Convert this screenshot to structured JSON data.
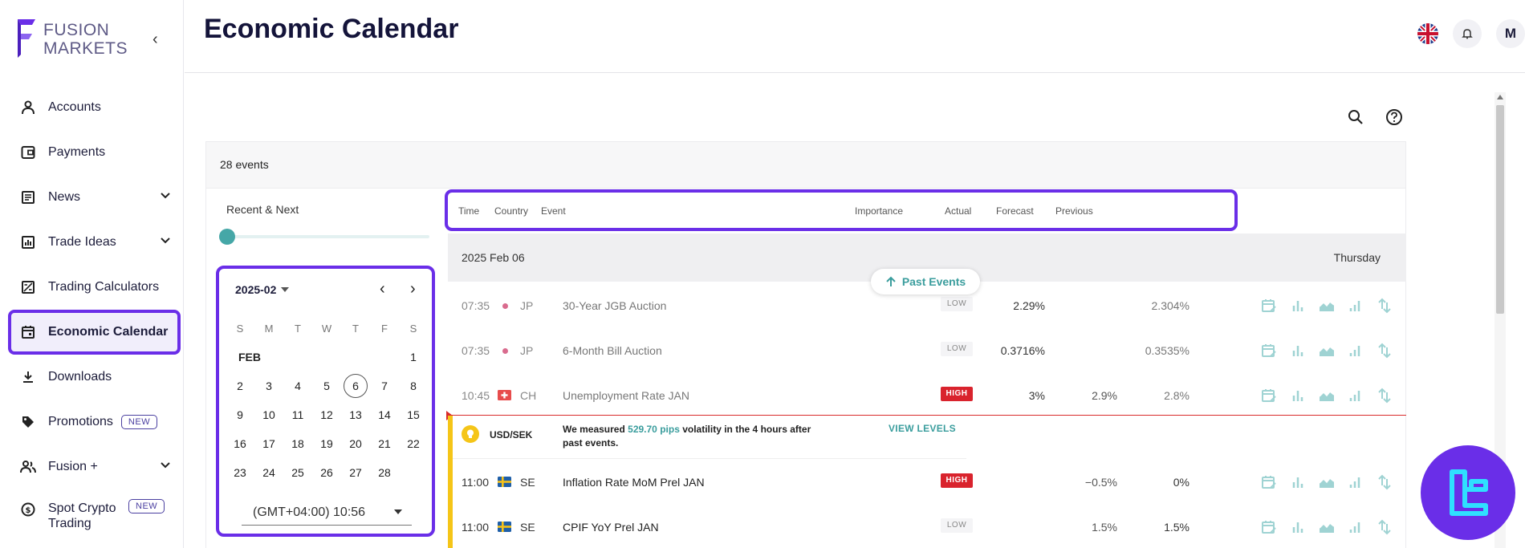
{
  "brand": {
    "line1": "FUSION",
    "line2": "MARKETS"
  },
  "page": {
    "title": "Economic Calendar"
  },
  "sidebar": {
    "items": [
      {
        "label": "Accounts"
      },
      {
        "label": "Payments"
      },
      {
        "label": "News"
      },
      {
        "label": "Trade Ideas"
      },
      {
        "label": "Trading Calculators"
      },
      {
        "label": "Economic Calendar"
      },
      {
        "label": "Downloads"
      },
      {
        "label": "Promotions",
        "badge": "NEW"
      },
      {
        "label": "Fusion +"
      },
      {
        "label": "Spot Crypto Trading",
        "badge": "NEW"
      }
    ]
  },
  "header": {
    "avatar": "M"
  },
  "panel": {
    "event_count": "28 events",
    "range_label": "Recent & Next"
  },
  "calendar": {
    "month_select": "2025-02",
    "weekdays": [
      "S",
      "M",
      "T",
      "W",
      "T",
      "F",
      "S"
    ],
    "month_label": "FEB",
    "selected_day": "6",
    "timezone": "(GMT+04:00) 10:56"
  },
  "table": {
    "headers": {
      "time": "Time",
      "country": "Country",
      "event": "Event",
      "importance": "Importance",
      "actual": "Actual",
      "forecast": "Forecast",
      "previous": "Previous"
    },
    "date": "2025 Feb 06",
    "weekday": "Thursday",
    "past_events": "Past Events",
    "rows": [
      {
        "time": "07:35",
        "country": "JP",
        "event": "30-Year JGB Auction",
        "importance": "LOW",
        "actual": "2.29%",
        "forecast": "",
        "previous": "2.304%"
      },
      {
        "time": "07:35",
        "country": "JP",
        "event": "6-Month Bill Auction",
        "importance": "LOW",
        "actual": "0.3716%",
        "forecast": "",
        "previous": "0.3535%"
      },
      {
        "time": "10:45",
        "country": "CH",
        "event": "Unemployment Rate JAN",
        "importance": "HIGH",
        "actual": "3%",
        "forecast": "2.9%",
        "previous": "2.8%"
      },
      {
        "time": "11:00",
        "country": "SE",
        "event": "Inflation Rate MoM Prel JAN",
        "importance": "HIGH",
        "actual": "",
        "forecast": "−0.5%",
        "previous": "0%"
      },
      {
        "time": "11:00",
        "country": "SE",
        "event": "CPIF YoY Prel JAN",
        "importance": "LOW",
        "actual": "",
        "forecast": "1.5%",
        "previous": "1.5%"
      }
    ],
    "volatility": {
      "pair": "USD/SEK",
      "text_before": "We measured ",
      "pips": "529.70 pips",
      "text_after": " volatility in the 4 hours after past events.",
      "link": "VIEW LEVELS"
    }
  },
  "colors": {
    "accent": "#6a2ee8",
    "teal": "#3a9d9d",
    "high": "#d9232d",
    "warning": "#f5c518"
  }
}
